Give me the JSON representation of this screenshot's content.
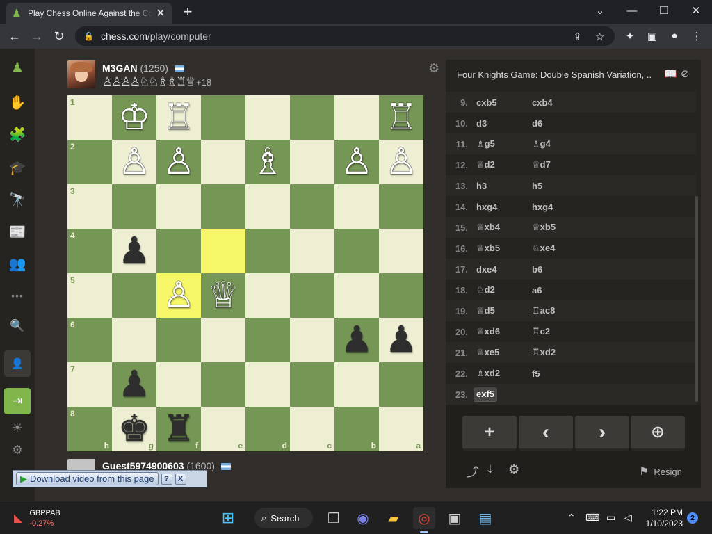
{
  "browser": {
    "tab_title": "Play Chess Online Against the Computer",
    "tab_close": "✕",
    "new_tab": "+",
    "url_domain": "chess.com",
    "url_path": "/play/computer",
    "win_min": "—",
    "win_max": "❐",
    "win_close": "✕",
    "nav_back": "←",
    "nav_fwd": "→",
    "nav_reload": "↻",
    "lock": "🔒",
    "share_icon": "⇪",
    "star_icon": "☆",
    "ext_icon": "✦",
    "side_icon": "▣",
    "profile_icon": "●",
    "menu_icon": "⋮",
    "tabs_down": "⌄"
  },
  "sidenav": {
    "items": [
      "♟",
      "✋",
      "🧩",
      "🎓",
      "🔭",
      "📰",
      "👥",
      "•••",
      "🔍"
    ],
    "signup_icon": "👤",
    "login_icon": "⇥",
    "sun_icon": "☀",
    "gear_icon": "⚙"
  },
  "opponent": {
    "name": "M3GAN",
    "rating": "(1250)",
    "captured": "♙♙♙♙♘♘♗♗♖♕",
    "advantage": "+18"
  },
  "player": {
    "name": "Guest5974900603",
    "rating": "(1600)"
  },
  "board": {
    "orientation": "black",
    "ranks": [
      "1",
      "2",
      "3",
      "4",
      "5",
      "6",
      "7",
      "8"
    ],
    "files": [
      "h",
      "g",
      "f",
      "e",
      "d",
      "c",
      "b",
      "a"
    ],
    "highlight": [
      "e4",
      "f5"
    ],
    "pieces": {
      "g1": "wK",
      "f1": "wR",
      "a1": "wR",
      "g2": "wP",
      "f2": "wP",
      "d2": "wB",
      "b2": "wP",
      "a2": "wP",
      "g4": "bP",
      "f5": "wP",
      "e5": "wQ",
      "b6": "bP",
      "a6": "bP",
      "g7": "bP",
      "g8": "bK",
      "f8": "bR"
    },
    "glyphs": {
      "wK": "♔",
      "wQ": "♕",
      "wR": "♖",
      "wB": "♗",
      "wN": "♘",
      "wP": "♙",
      "bK": "♚",
      "bQ": "♛",
      "bR": "♜",
      "bB": "♝",
      "bN": "♞",
      "bP": "♟"
    }
  },
  "download_bar": {
    "label": "Download video from this page",
    "help": "?",
    "close": "X"
  },
  "panel": {
    "opening": "Four Knights Game: Double Spanish Variation, ...",
    "book_icon": "📖",
    "compass_icon": "⊘",
    "moves": [
      {
        "n": "9.",
        "w": "cxb5",
        "b": "cxb4"
      },
      {
        "n": "10.",
        "w": "d3",
        "b": "d6"
      },
      {
        "n": "11.",
        "w": "♗g5",
        "b": "♗g4"
      },
      {
        "n": "12.",
        "w": "♕d2",
        "b": "♕d7"
      },
      {
        "n": "13.",
        "w": "h3",
        "b": "h5"
      },
      {
        "n": "14.",
        "w": "hxg4",
        "b": "hxg4"
      },
      {
        "n": "15.",
        "w": "♕xb4",
        "b": "♕xb5"
      },
      {
        "n": "16.",
        "w": "♕xb5",
        "b": "♘xe4"
      },
      {
        "n": "17.",
        "w": "dxe4",
        "b": "b6"
      },
      {
        "n": "18.",
        "w": "♘d2",
        "b": "a6"
      },
      {
        "n": "19.",
        "w": "♕d5",
        "b": "♖ac8"
      },
      {
        "n": "20.",
        "w": "♕xd6",
        "b": "♖c2"
      },
      {
        "n": "21.",
        "w": "♕xe5",
        "b": "♖xd2"
      },
      {
        "n": "22.",
        "w": "♗xd2",
        "b": "f5"
      },
      {
        "n": "23.",
        "w": "exf5",
        "b": ""
      }
    ],
    "controls": [
      "+",
      "‹",
      "›",
      "⊕"
    ],
    "share_icon": "⤴",
    "download_icon": "⤓",
    "settings_icon": "⚙",
    "resign_flag": "⚑",
    "resign_label": "Resign"
  },
  "taskbar": {
    "ticker_symbol": "GBPPAB",
    "ticker_change": "-0.27%",
    "search_label": "Search",
    "time": "1:22 PM",
    "date": "1/10/2023",
    "notifications": "2"
  }
}
